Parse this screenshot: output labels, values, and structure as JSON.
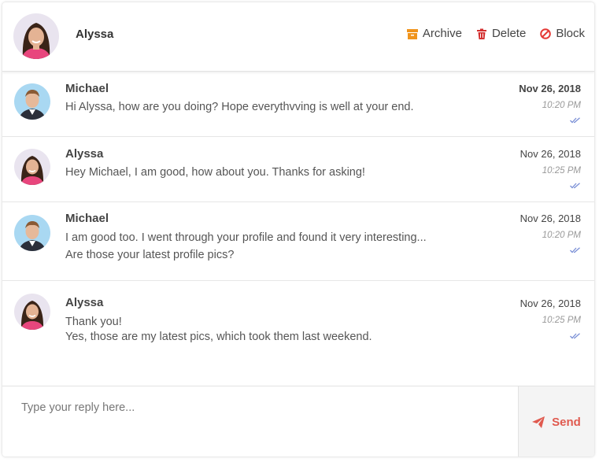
{
  "header": {
    "name": "Alyssa",
    "actions": [
      {
        "label": "Archive",
        "icon": "archive-icon",
        "color": "#f0941c"
      },
      {
        "label": "Delete",
        "icon": "trash-icon",
        "color": "#d32f2f"
      },
      {
        "label": "Block",
        "icon": "block-icon",
        "color": "#e53935"
      }
    ]
  },
  "messages": [
    {
      "sender": "Michael",
      "lines": [
        "Hi Alyssa, how are you doing? Hope everythvving is well at your end."
      ],
      "date": "Nov 26, 2018",
      "time": "10:20 PM",
      "unread": true
    },
    {
      "sender": "Alyssa",
      "lines": [
        "Hey Michael, I am good, how about you. Thanks for asking!"
      ],
      "date": "Nov 26, 2018",
      "time": "10:25 PM",
      "unread": false
    },
    {
      "sender": "Michael",
      "lines": [
        "I am good too. I went through your profile and found it very interesting...",
        "Are those your latest profile pics?"
      ],
      "date": "Nov 26, 2018",
      "time": "10:20 PM",
      "unread": false
    },
    {
      "sender": "Alyssa",
      "lines": [
        "Thank you!",
        "Yes, those are my latest pics, which took them last weekend."
      ],
      "date": "Nov 26, 2018",
      "time": "10:25 PM",
      "unread": false
    }
  ],
  "composer": {
    "placeholder": "Type your reply here...",
    "send_label": "Send",
    "send_color": "#e05a4f"
  },
  "colors": {
    "read_check": "#7a8fd6"
  }
}
